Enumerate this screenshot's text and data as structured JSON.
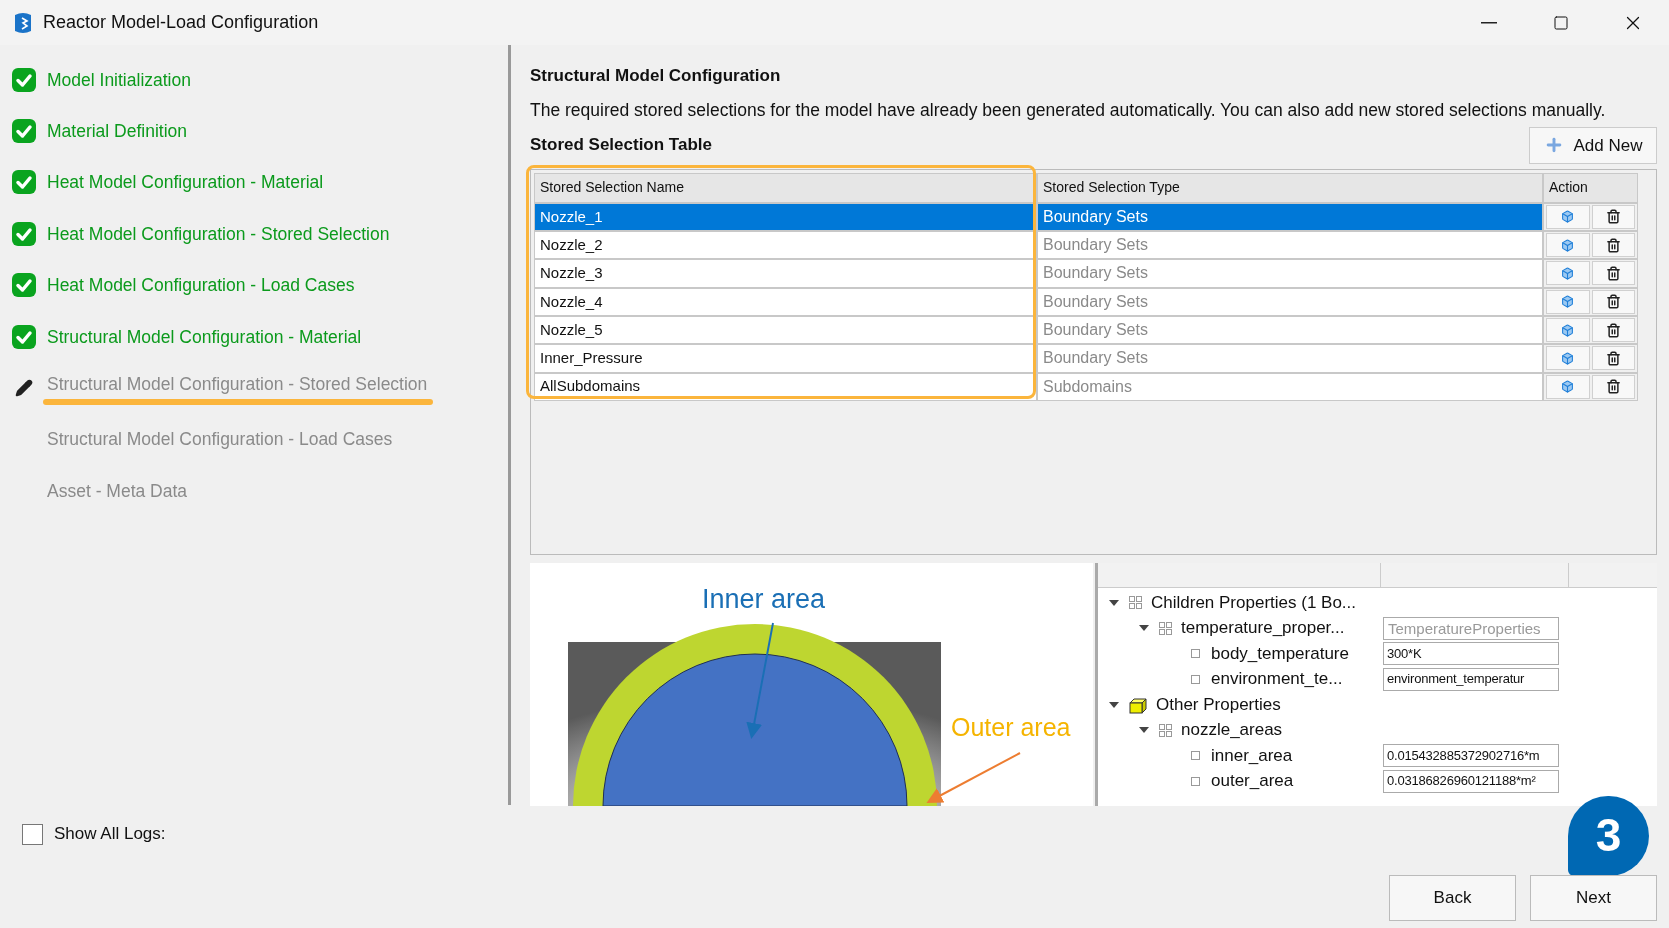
{
  "window": {
    "title": "Reactor Model-Load Configuration"
  },
  "steps": [
    {
      "label": "Model Initialization",
      "kind": "done"
    },
    {
      "label": "Material Definition",
      "kind": "done"
    },
    {
      "label": "Heat Model Configuration - Material",
      "kind": "done"
    },
    {
      "label": "Heat Model Configuration - Stored Selection",
      "kind": "done"
    },
    {
      "label": "Heat Model Configuration - Load Cases",
      "kind": "done"
    },
    {
      "label": "Structural Model Configuration - Material",
      "kind": "done"
    },
    {
      "label": "Structural Model Configuration - Stored Selection",
      "kind": "current"
    },
    {
      "label": "Structural Model Configuration - Load Cases",
      "kind": "pending"
    },
    {
      "label": "Asset - Meta Data",
      "kind": "pending"
    }
  ],
  "show_all_logs": {
    "label": "Show All Logs:",
    "checked": false
  },
  "content": {
    "heading": "Structural Model Configuration",
    "description": "The required stored selections for the model have already been generated automatically. You can also add new stored selections manually.",
    "table_title": "Stored Selection Table",
    "add_button": "Add New",
    "table": {
      "columns": [
        "Stored Selection Name",
        "Stored Selection Type",
        "Action"
      ],
      "rows": [
        {
          "name": "Nozzle_1",
          "type": "Boundary Sets",
          "selected": true
        },
        {
          "name": "Nozzle_2",
          "type": "Boundary Sets",
          "selected": false
        },
        {
          "name": "Nozzle_3",
          "type": "Boundary Sets",
          "selected": false
        },
        {
          "name": "Nozzle_4",
          "type": "Boundary Sets",
          "selected": false
        },
        {
          "name": "Nozzle_5",
          "type": "Boundary Sets",
          "selected": false
        },
        {
          "name": "Inner_Pressure",
          "type": "Boundary Sets",
          "selected": false
        },
        {
          "name": "AllSubdomains",
          "type": "Subdomains",
          "selected": false
        }
      ]
    }
  },
  "figure": {
    "inner_label": "Inner area",
    "outer_label": "Outer area"
  },
  "properties": [
    {
      "label": "Children Properties (1 Bo...",
      "kind": "group",
      "expanded": true,
      "children": [
        {
          "label": "temperature_proper...",
          "kind": "group",
          "expanded": true,
          "placeholder": "TemperatureProperties",
          "children": [
            {
              "label": "body_temperature",
              "kind": "leaf",
              "value": "300*K"
            },
            {
              "label": "environment_te...",
              "kind": "leaf",
              "value": "environment_temperatur"
            }
          ]
        }
      ]
    },
    {
      "label": "Other Properties",
      "kind": "category",
      "expanded": true,
      "children": [
        {
          "label": "nozzle_areas",
          "kind": "group",
          "expanded": true,
          "children": [
            {
              "label": "inner_area",
              "kind": "leaf",
              "value": "0.015432885372902716*m"
            },
            {
              "label": "outer_area",
              "kind": "leaf",
              "value": "0.03186826960121188*m²"
            }
          ]
        }
      ]
    }
  ],
  "step_badge": "3",
  "buttons": [
    "Back",
    "Next"
  ]
}
